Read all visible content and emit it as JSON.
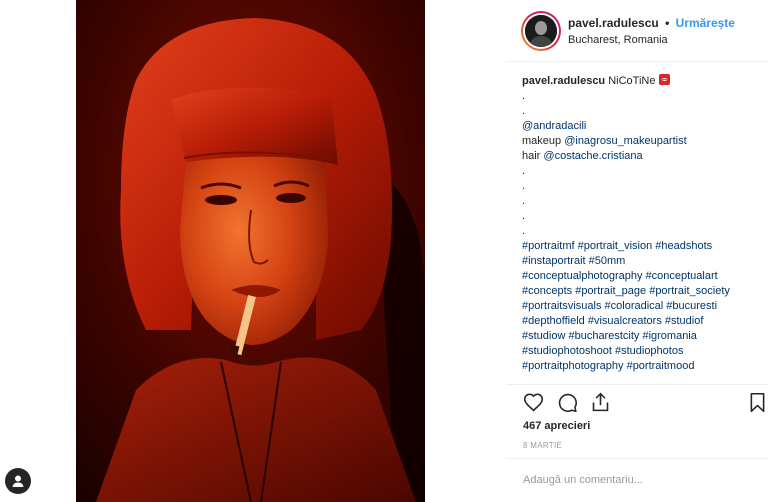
{
  "post": {
    "username": "pavel.radulescu",
    "dot": "•",
    "follow_label": "Urmărește",
    "location": "Bucharest, Romania"
  },
  "caption": {
    "username": "pavel.radulescu",
    "title": "NiCoTiNe",
    "dot1": ".",
    "dot2": ".",
    "mention_model": "@andradacili",
    "makeup_label": "makeup",
    "makeup_mention": "@inagrosu_makeupartist",
    "hair_label": "hair",
    "hair_mention": "@costache.cristiana",
    "dot3": ".",
    "dot4": ".",
    "dot5": ".",
    "dot6": ".",
    "dot7": ".",
    "hashtag_lines": [
      "#portraitmf #portrait_vision #headshots",
      "#instaportrait #50mm",
      "#conceptualphotography #conceptualart",
      "#concepts #portrait_page #portrait_society",
      "#portraitsvisuals #coloradical #bucuresti",
      "#depthoffield #visualcreators #studiof",
      "#studiow #bucharestcity #igromania",
      "#studiophotoshoot #studiophotos",
      "#portraitphotography #portraitmood"
    ]
  },
  "actions": {
    "like_icon": "heart-icon",
    "comment_icon": "comment-icon",
    "share_icon": "share-icon",
    "save_icon": "bookmark-icon"
  },
  "likes": "467 aprecieri",
  "date": "8 MARTIE",
  "comment": {
    "placeholder": "Adaugă un comentariu..."
  },
  "colors": {
    "link": "#003569",
    "follow": "#3897f0",
    "photo_red": "#c21a06"
  }
}
